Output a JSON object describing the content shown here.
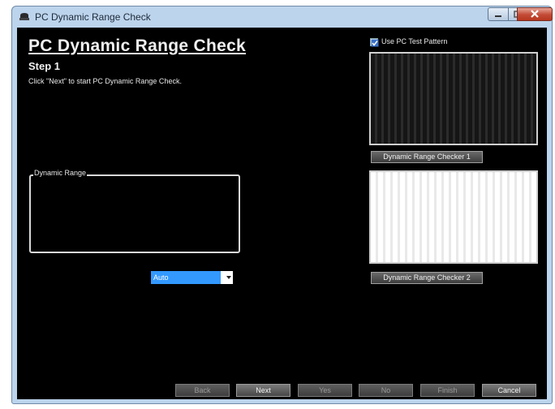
{
  "window": {
    "title": "PC Dynamic Range Check"
  },
  "main": {
    "heading": "PC Dynamic Range Check",
    "step": "Step 1",
    "instruction": "Click \"Next\" to start PC Dynamic Range Check.",
    "dynamic_range_group_label": "Dynamic Range",
    "range_select_value": "Auto"
  },
  "preview": {
    "use_test_pattern_label": "Use PC Test Pattern",
    "use_test_pattern_checked": true,
    "checker1_label": "Dynamic Range Checker 1",
    "checker2_label": "Dynamic Range Checker 2"
  },
  "footer": {
    "back": "Back",
    "next": "Next",
    "yes": "Yes",
    "no": "No",
    "finish": "Finish",
    "cancel": "Cancel"
  },
  "colors": {
    "background": "#000000",
    "select_highlight": "#3399ff",
    "titlebar": "#bcd4ec"
  }
}
